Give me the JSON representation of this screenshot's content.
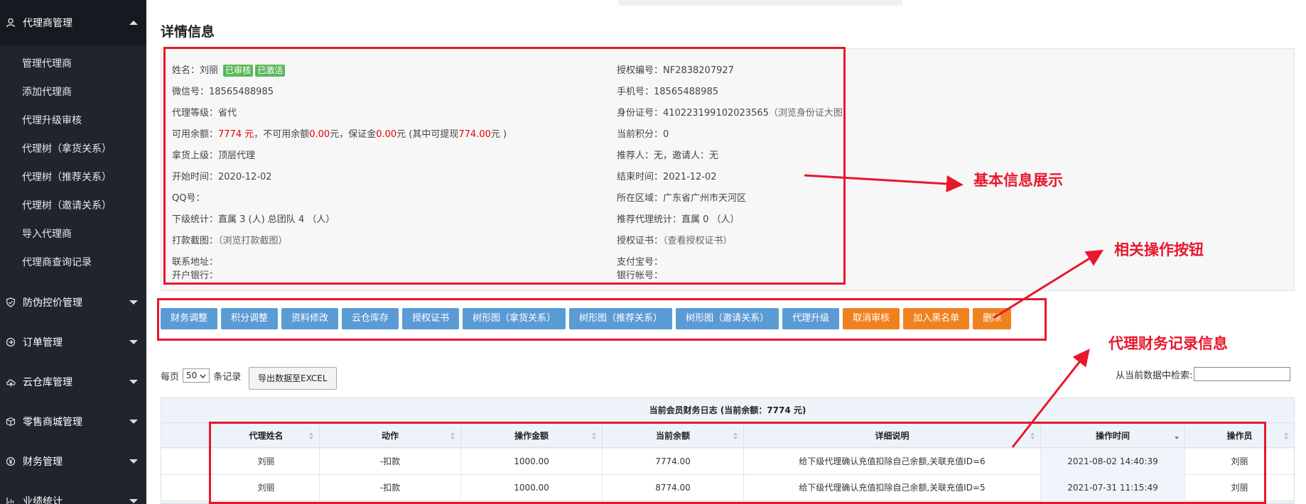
{
  "sidebar": {
    "sections": [
      {
        "label": "代理商管理",
        "icon": "user-icon",
        "expanded": true,
        "items": [
          "管理代理商",
          "添加代理商",
          "代理升级审核",
          "代理树（拿货关系）",
          "代理树（推荐关系）",
          "代理树（邀请关系）",
          "导入代理商",
          "代理商查询记录"
        ]
      },
      {
        "label": "防伪控价管理",
        "icon": "shield-icon",
        "expanded": false
      },
      {
        "label": "订单管理",
        "icon": "order-icon",
        "expanded": false
      },
      {
        "label": "云仓库管理",
        "icon": "cloud-icon",
        "expanded": false
      },
      {
        "label": "零售商城管理",
        "icon": "box-icon",
        "expanded": false
      },
      {
        "label": "财务管理",
        "icon": "yen-icon",
        "expanded": false
      },
      {
        "label": "业绩统计",
        "icon": "chart-icon",
        "expanded": false
      }
    ]
  },
  "page_title": "详情信息",
  "info": {
    "name_label": "姓名：",
    "name": "刘丽",
    "badge_reviewed": "已审核",
    "badge_activated": "已激活",
    "wechat": "微信号：18565488985",
    "level": "代理等级：省代",
    "balance_prefix": "可用余额：",
    "balance": "7774 元",
    "balance_mid1": "，不可用余额",
    "unavailable": "0.00",
    "balance_mid2": "元，保证金",
    "deposit": "0.00",
    "balance_mid3": "元 (其中可提现",
    "withdrawable": "774.00",
    "balance_suffix": "元 )",
    "upline": "拿货上级：顶层代理",
    "start_time": "开始时间：2020-12-02",
    "qq": "QQ号：",
    "sub_stats": "下级统计：直属 3 (人) 总团队 4 （人）",
    "payment_shot_label": "打款截图：",
    "payment_shot_link": "（浏览打款截图）",
    "address": "联系地址：",
    "bank": "开户银行：",
    "auth_no": "授权编号：NF2838207927",
    "phone": "手机号：18565488985",
    "id_card": "身份证号：410223199102023565",
    "id_card_link": "（浏览身份证大图）",
    "points": "当前积分：0",
    "referrer": "推荐人：无，邀请人：无",
    "end_time": "结束时间：2021-12-02",
    "region": "所在区域：广东省广州市天河区",
    "ref_stats": "推荐代理统计：直属 0 （人）",
    "cert_label": "授权证书：",
    "cert_link": "（查看授权证书）",
    "alipay": "支付宝号：",
    "bank_account": "银行帐号："
  },
  "annotations": {
    "basic_info": "基本信息展示",
    "buttons": "相关操作按钮",
    "finance": "代理财务记录信息"
  },
  "actions": [
    {
      "label": "财务调整",
      "style": "blue"
    },
    {
      "label": "积分调整",
      "style": "blue"
    },
    {
      "label": "资料修改",
      "style": "blue"
    },
    {
      "label": "云仓库存",
      "style": "blue"
    },
    {
      "label": "授权证书",
      "style": "blue"
    },
    {
      "label": "树形图（拿货关系）",
      "style": "blue"
    },
    {
      "label": "树形图（推荐关系）",
      "style": "blue"
    },
    {
      "label": "树形图（邀请关系）",
      "style": "blue"
    },
    {
      "label": "代理升级",
      "style": "blue"
    },
    {
      "label": "取消审核",
      "style": "orange"
    },
    {
      "label": "加入黑名单",
      "style": "orange"
    },
    {
      "label": "删除",
      "style": "orange"
    }
  ],
  "table_controls": {
    "per_page_prefix": "每页",
    "per_page_value": "50",
    "per_page_suffix": "条记录",
    "export_label": "导出数据至EXCEL",
    "search_label": "从当前数据中检索:",
    "search_value": ""
  },
  "finance_table": {
    "caption": "当前会员财务日志 (当前余额：7774 元)",
    "columns": [
      "代理姓名",
      "动作",
      "操作金额",
      "当前余额",
      "详细说明",
      "操作时间",
      "操作员"
    ],
    "sorted_column": 5,
    "rows": [
      [
        "刘丽",
        "-扣款",
        "1000.00",
        "7774.00",
        "给下级代理确认充值扣除自己余额,关联充值ID=6",
        "2021-08-02 14:40:39",
        "刘丽"
      ],
      [
        "刘丽",
        "-扣款",
        "1000.00",
        "8774.00",
        "给下级代理确认充值扣除自己余额,关联充值ID=5",
        "2021-07-31 11:15:49",
        "刘丽"
      ]
    ]
  },
  "colors": {
    "sidebar_bg": "#20252d",
    "button_blue": "#5b9bd5",
    "button_orange": "#f0811f",
    "annotation_red": "#e8172c",
    "badge_green": "#5cb85c"
  }
}
